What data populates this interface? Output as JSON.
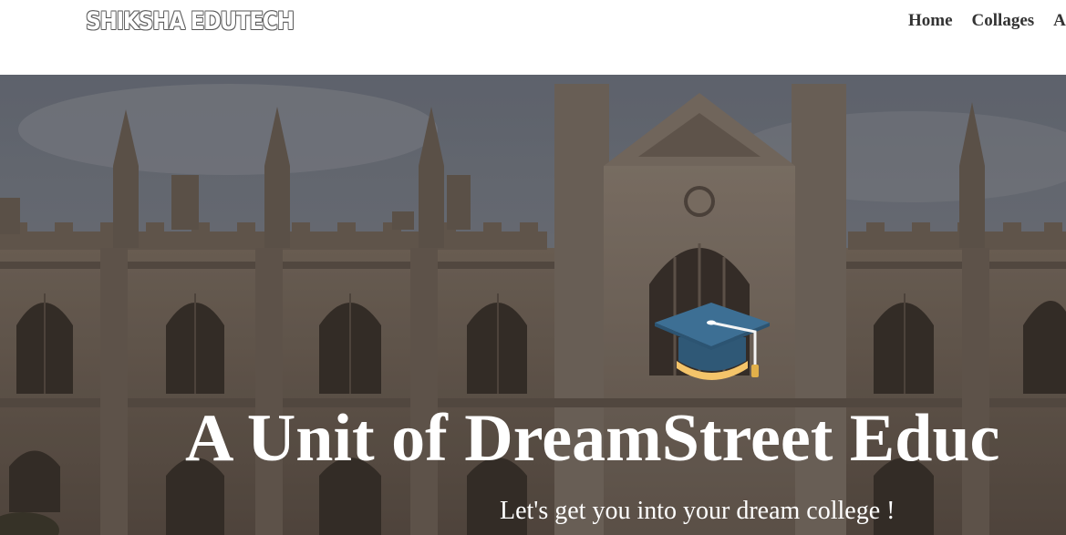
{
  "header": {
    "logo_text": "SHIKSHA EDUTECH",
    "nav_items": [
      {
        "label": "Home"
      },
      {
        "label": "Collages"
      },
      {
        "label": "A"
      }
    ]
  },
  "hero": {
    "background_image": "college-building-photo",
    "icon": "graduation-cap-icon",
    "title": "A Unit of DreamStreet Educ",
    "subtitle": "Let's get you into your dream college !"
  },
  "colors": {
    "nav_text": "#333333",
    "hero_text": "#ffffff",
    "cap_blue": "#3d6f94",
    "cap_gold": "#f4c46a"
  }
}
